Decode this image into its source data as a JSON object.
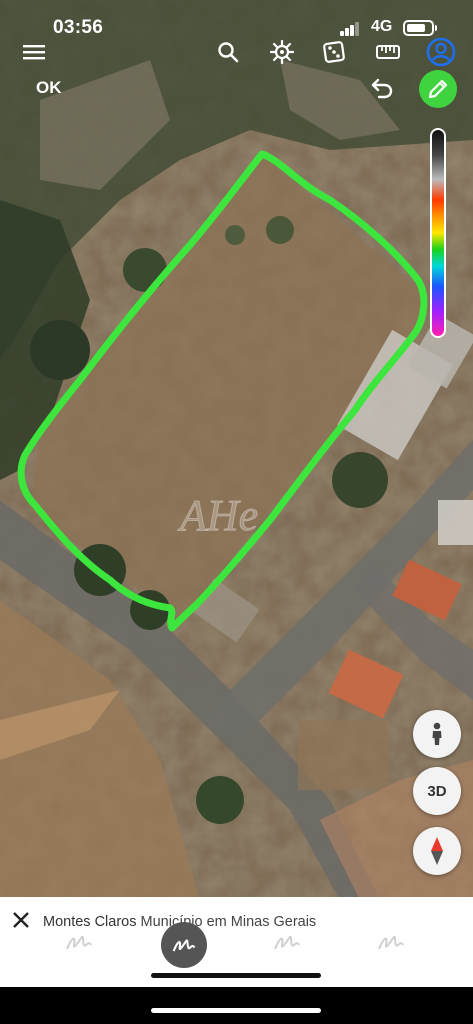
{
  "status_bar": {
    "time": "03:56",
    "network": "4G"
  },
  "toolbar": {
    "ok_label": "OK",
    "icons": [
      "menu-icon",
      "search-icon",
      "ships-wheel-icon",
      "dice-icon",
      "ruler-icon",
      "account-icon",
      "undo-icon",
      "pencil-icon"
    ]
  },
  "map": {
    "watermark": "AHe",
    "outline_color": "#3de63d"
  },
  "controls": {
    "three_d_label": "3D",
    "pegman_icon": "pegman-icon",
    "compass_icon": "compass-icon"
  },
  "bottom_panel": {
    "place_name": "Montes Claros",
    "place_subtitle": "Município em Minas Gerais"
  }
}
